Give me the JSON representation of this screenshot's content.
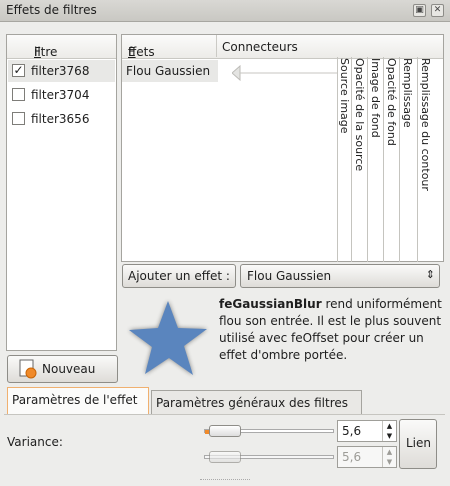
{
  "window": {
    "title": "Effets de filtres",
    "buttons": [
      "restore",
      "close"
    ]
  },
  "filters": {
    "header": "Filtre",
    "items": [
      {
        "label": "filter3768",
        "checked": true
      },
      {
        "label": "filter3704",
        "checked": false
      },
      {
        "label": "filter3656",
        "checked": false
      }
    ],
    "new_button": "Nouveau"
  },
  "effects": {
    "headers": [
      "Effets",
      "Connecteurs"
    ],
    "rows": [
      {
        "label": "Flou Gaussien"
      }
    ],
    "connectors": [
      "Source image",
      "Opacité de la source",
      "Image de fond",
      "Opacité de fond",
      "Remplissage",
      "Remplissage du contour"
    ],
    "add_button": "Ajouter un effet :",
    "add_select": "Flou Gaussien"
  },
  "description": {
    "name": "feGaussianBlur",
    "text": "rend uniformément flou son entrée. Il est le plus souvent utilisé avec feOffset pour créer un effet d'ombre portée."
  },
  "tabs": [
    {
      "label": "Paramètres de l'effet",
      "active": true
    },
    {
      "label": "Paramètres généraux des filtres",
      "active": false
    }
  ],
  "params": {
    "variance_label": "Variance:",
    "value1": "5,6",
    "value2": "5,6",
    "link_button": "Lien",
    "slider_level": 0.17
  }
}
